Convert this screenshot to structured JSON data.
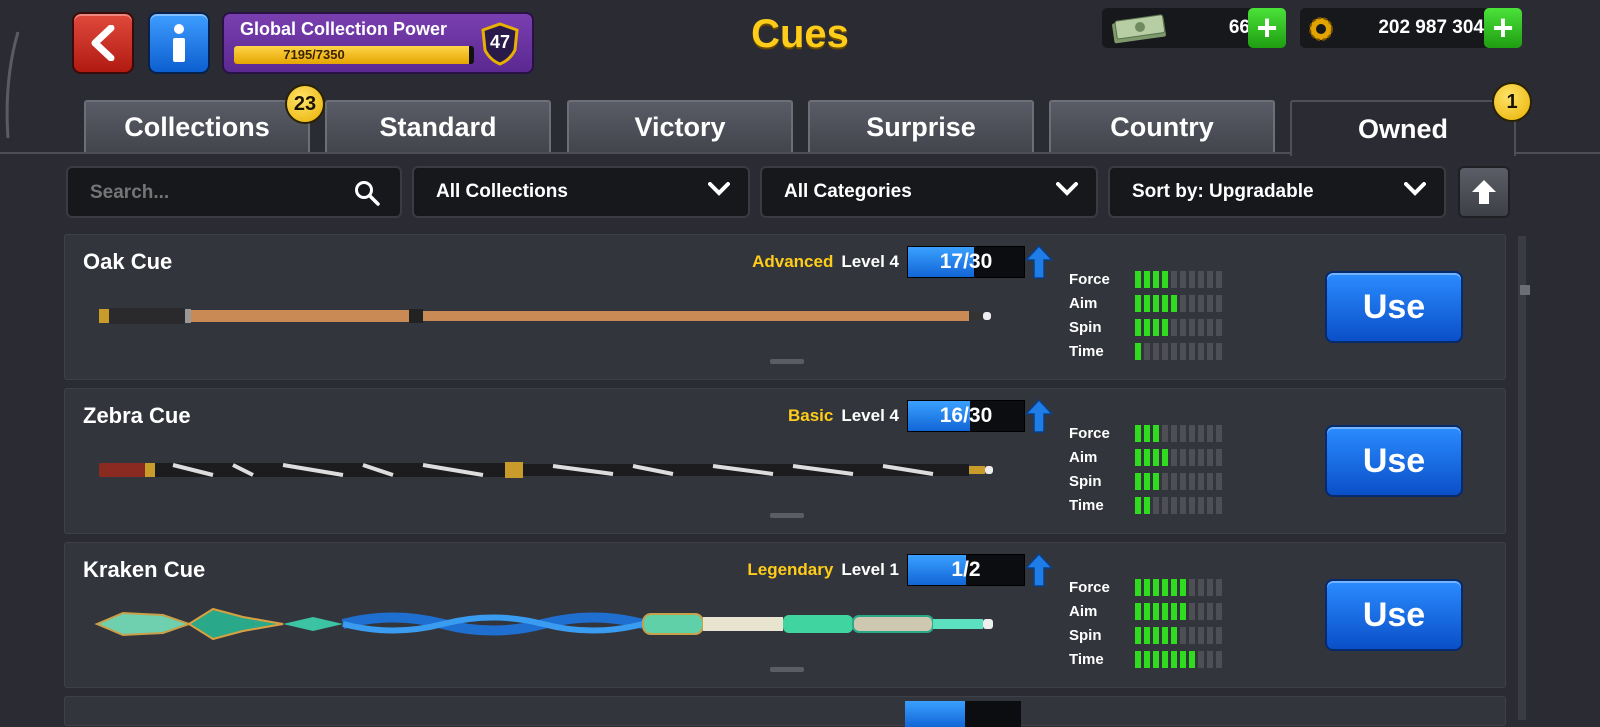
{
  "header": {
    "title": "Cues",
    "back_icon": "back-arrow-icon",
    "info_icon": "info-icon",
    "collection_power": {
      "label": "Global Collection Power",
      "value_text": "7195/7350",
      "progress": 0.979,
      "level": "47"
    },
    "cash": {
      "amount": "66",
      "icon": "cash-icon"
    },
    "coins": {
      "amount": "202 987 304",
      "icon": "coins-icon"
    },
    "plus_label": "+"
  },
  "tabs": [
    {
      "label": "Collections",
      "badge": "23"
    },
    {
      "label": "Standard"
    },
    {
      "label": "Victory"
    },
    {
      "label": "Surprise"
    },
    {
      "label": "Country"
    },
    {
      "label": "Owned",
      "badge": "1",
      "active": true
    }
  ],
  "filters": {
    "search_placeholder": "Search...",
    "collection": "All Collections",
    "category": "All Categories",
    "sort": "Sort by: Upgradable"
  },
  "stat_labels": [
    "Force",
    "Aim",
    "Spin",
    "Time"
  ],
  "use_label": "Use",
  "colors": {
    "accent_gold": "#ffcc1a",
    "stat_on": "#2fdc1e",
    "use_blue": "#1a6fe8"
  },
  "cues": [
    {
      "name": "Oak Cue",
      "rarity": "Advanced",
      "level": "Level 4",
      "progress_text": "17/30",
      "progress": 0.567,
      "stats": [
        4,
        5,
        4,
        1
      ]
    },
    {
      "name": "Zebra Cue",
      "rarity": "Basic",
      "level": "Level 4",
      "progress_text": "16/30",
      "progress": 0.533,
      "stats": [
        3,
        4,
        3,
        2
      ]
    },
    {
      "name": "Kraken Cue",
      "rarity": "Legendary",
      "level": "Level 1",
      "progress_text": "1/2",
      "progress": 0.5,
      "stats": [
        6,
        6,
        5,
        7
      ]
    }
  ]
}
